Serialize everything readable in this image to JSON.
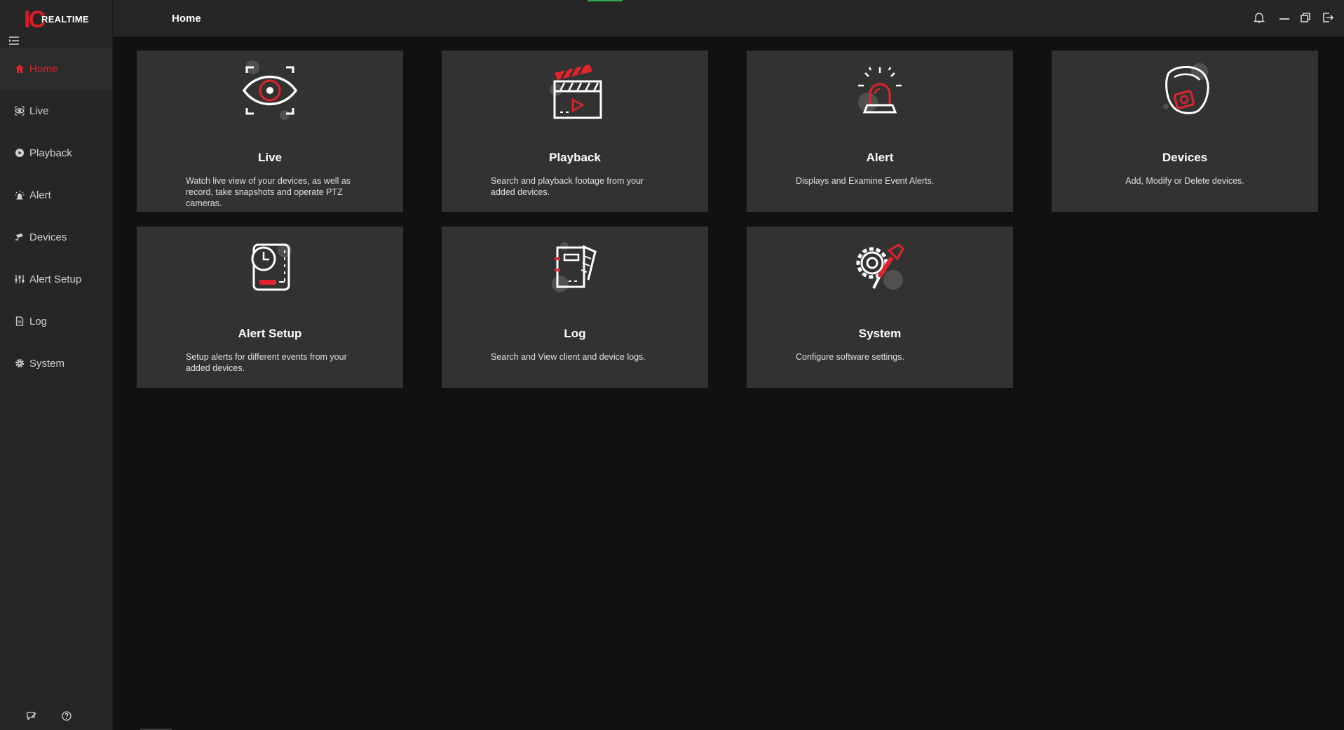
{
  "app": {
    "logo_mark": "IC",
    "logo_text": "REALTIME"
  },
  "header": {
    "title": "Home"
  },
  "sidebar": {
    "items": [
      {
        "label": "Home",
        "icon": "home-icon",
        "active": true
      },
      {
        "label": "Live",
        "icon": "eye-icon"
      },
      {
        "label": "Playback",
        "icon": "play-icon"
      },
      {
        "label": "Alert",
        "icon": "siren-icon"
      },
      {
        "label": "Devices",
        "icon": "camera-icon"
      },
      {
        "label": "Alert Setup",
        "icon": "sliders-icon"
      },
      {
        "label": "Log",
        "icon": "document-icon"
      },
      {
        "label": "System",
        "icon": "gear-icon"
      }
    ]
  },
  "cards": [
    {
      "title": "Live",
      "desc": "Watch live view of your devices, as well as record, take snapshots and operate PTZ cameras."
    },
    {
      "title": "Playback",
      "desc": "Search and playback footage from your added devices."
    },
    {
      "title": "Alert",
      "desc": "Displays and Examine Event Alerts."
    },
    {
      "title": "Devices",
      "desc": "Add, Modify or Delete devices."
    },
    {
      "title": "Alert Setup",
      "desc": "Setup alerts for different events from your added devices."
    },
    {
      "title": "Log",
      "desc": "Search and View client and device logs."
    },
    {
      "title": "System",
      "desc": "Configure software settings."
    }
  ],
  "colors": {
    "accent": "#e2232b",
    "card_bg": "#323232",
    "sidebar_bg": "#262626",
    "page_bg": "#111111"
  }
}
